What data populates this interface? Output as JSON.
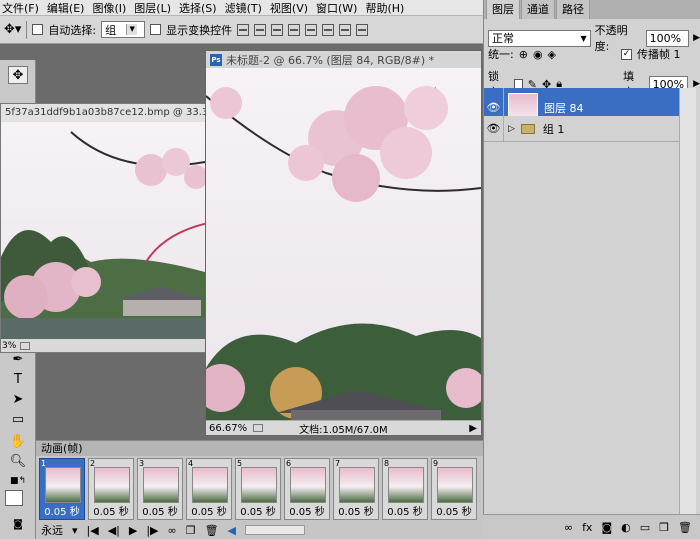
{
  "menu": [
    "文件(F)",
    "编辑(E)",
    "图像(I)",
    "图层(L)",
    "选择(S)",
    "滤镜(T)",
    "视图(V)",
    "窗口(W)",
    "帮助(H)"
  ],
  "options": {
    "auto_select_label": "自动选择:",
    "auto_select_value": "组",
    "show_transform_label": "显示变换控件"
  },
  "doc1": {
    "title": "5f37a31ddf9b1a03b87ce12.bmp @ 33.3...",
    "zoom": "3%"
  },
  "doc2": {
    "ps_badge": "Ps",
    "title": "未标题-2 @ 66.7% (图层 84, RGB/8#) *",
    "zoom": "66.67%",
    "docsize": "文档:1.05M/67.0M"
  },
  "animation": {
    "tab": "动画(帧)",
    "frames": [
      {
        "num": "1",
        "delay": "0.05 秒"
      },
      {
        "num": "2",
        "delay": "0.05 秒"
      },
      {
        "num": "3",
        "delay": "0.05 秒"
      },
      {
        "num": "4",
        "delay": "0.05 秒"
      },
      {
        "num": "5",
        "delay": "0.05 秒"
      },
      {
        "num": "6",
        "delay": "0.05 秒"
      },
      {
        "num": "7",
        "delay": "0.05 秒"
      },
      {
        "num": "8",
        "delay": "0.05 秒"
      },
      {
        "num": "9",
        "delay": "0.05 秒"
      }
    ],
    "loop": "永远"
  },
  "layers_panel": {
    "tabs": [
      "图层",
      "通道",
      "路径"
    ],
    "blend_mode": "正常",
    "opacity_label": "不透明度:",
    "opacity": "100%",
    "unify_label": "统一:",
    "propagate_label": "传播帧 1",
    "lock_label": "锁定:",
    "fill_label": "填充:",
    "fill": "100%",
    "layers": [
      {
        "name": "图层 84",
        "selected": true
      },
      {
        "name": "组 1",
        "selected": false
      }
    ]
  },
  "colors": {
    "selection": "#3a6ec2",
    "blossom": "#e9bccd",
    "sky": "#f3eef2"
  }
}
